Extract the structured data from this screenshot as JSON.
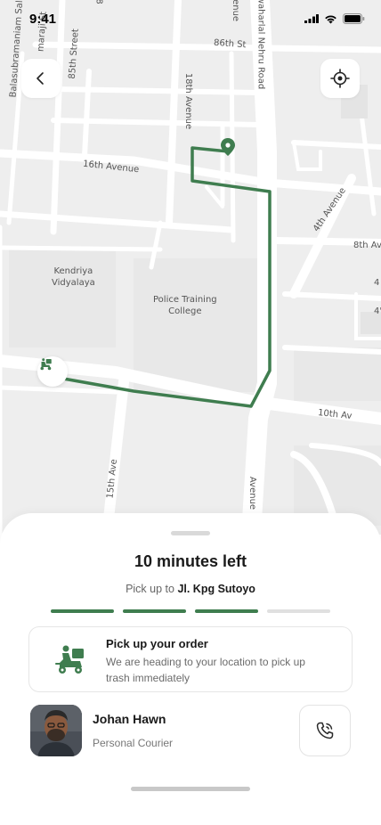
{
  "status_bar": {
    "time": "9:41"
  },
  "map": {
    "streets": {
      "balasubramaniam": "Balasubramaniam Salai",
      "rajaji": "maraji St",
      "street_85th": "85th Street",
      "street_86th": "86th St",
      "avenue_18th": "18th Avenue",
      "nehru_road": "Jawaharlal Nehru Road",
      "avenue_16th": "16th Avenue",
      "avenue_4th": "4th Avenue",
      "avenue_8th": "8th Av",
      "partial_4a": "4",
      "partial_4b": "4'",
      "avenue_10th": "10th Av",
      "avenue_15th": "15th Ave",
      "avenue_bottom": "Avenue",
      "top_partial": "8",
      "top_avenue": "Avenue"
    },
    "places": {
      "kendriya": "Kendriya\nVidyalaya",
      "police": "Police Training\nCollege"
    },
    "route_color": "#3f7d4f"
  },
  "delivery": {
    "time_left": "10 minutes left",
    "pickup_prefix": "Pick up to ",
    "pickup_location": "Jl. Kpg Sutoyo",
    "progress_total": 4,
    "progress_done": 3
  },
  "info_card": {
    "title": "Pick up your order",
    "description": "We are heading to your location to pick up trash immediately",
    "icon": "delivery-scooter-icon"
  },
  "courier": {
    "name": "Johan Hawn",
    "role": "Personal Courier"
  },
  "colors": {
    "accent": "#3f7d4f",
    "map_bg": "#eeeeee",
    "road": "#ffffff"
  }
}
